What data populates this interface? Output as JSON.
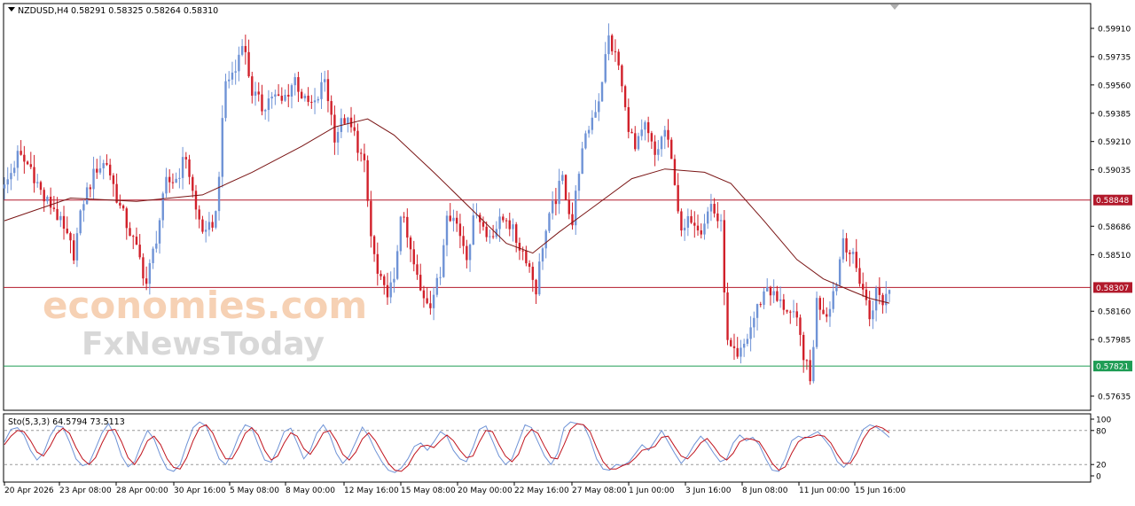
{
  "window": {
    "symbol_label": "NZDUSD,H4",
    "ohlc_label": "0.58291 0.58325 0.58264 0.58310",
    "stoch_label": "Sto(5,3,3) 64.5794 73.5113"
  },
  "watermark": {
    "line1": "economies.com",
    "line2": "FxNewsToday"
  },
  "colors": {
    "bull": "#6f93d6",
    "bear": "#d1202a",
    "ma": "#7a1515",
    "resistance": "#b2192b",
    "support": "#1f9d55",
    "stoch_main": "#6f93d6",
    "stoch_signal": "#c0141e"
  },
  "chart_data": [
    {
      "type": "candlestick",
      "title": "NZDUSD,H4",
      "ylim": [
        0.57635,
        0.5999
      ],
      "y_ticks": [
        "0.59910",
        "0.59735",
        "0.59560",
        "0.59385",
        "0.59210",
        "0.59035",
        "0.58686",
        "0.58510",
        "0.58160",
        "0.57985",
        "0.57635"
      ],
      "x_ticks": [
        "20 Apr 2026",
        "23 Apr 08:00",
        "28 Apr 00:00",
        "30 Apr 16:00",
        "5 May 08:00",
        "8 May 00:00",
        "12 May 16:00",
        "15 May 08:00",
        "20 May 00:00",
        "22 May 16:00",
        "27 May 08:00",
        "1 Jun 00:00",
        "3 Jun 16:00",
        "8 Jun 08:00",
        "11 Jun 00:00",
        "15 Jun 16:00"
      ],
      "levels": [
        {
          "value": "0.58848",
          "kind": "resistance"
        },
        {
          "value": "0.58307",
          "kind": "current"
        },
        {
          "value": "0.57821",
          "kind": "support"
        }
      ],
      "anchors": [
        [
          0,
          0.5892
        ],
        [
          4,
          0.5912
        ],
        [
          8,
          0.5905
        ],
        [
          12,
          0.5885
        ],
        [
          15,
          0.588
        ],
        [
          18,
          0.5865
        ],
        [
          21,
          0.5852
        ],
        [
          24,
          0.5885
        ],
        [
          28,
          0.5905
        ],
        [
          31,
          0.5908
        ],
        [
          35,
          0.588
        ],
        [
          38,
          0.5865
        ],
        [
          41,
          0.5848
        ],
        [
          43,
          0.5833
        ],
        [
          46,
          0.5862
        ],
        [
          49,
          0.5895
        ],
        [
          52,
          0.5898
        ],
        [
          55,
          0.5912
        ],
        [
          58,
          0.5878
        ],
        [
          61,
          0.5862
        ],
        [
          64,
          0.5876
        ],
        [
          67,
          0.5958
        ],
        [
          70,
          0.5965
        ],
        [
          72,
          0.5985
        ],
        [
          75,
          0.5952
        ],
        [
          78,
          0.5942
        ],
        [
          81,
          0.595
        ],
        [
          84,
          0.5945
        ],
        [
          88,
          0.596
        ],
        [
          91,
          0.5945
        ],
        [
          94,
          0.5943
        ],
        [
          97,
          0.596
        ],
        [
          100,
          0.5925
        ],
        [
          103,
          0.5935
        ],
        [
          106,
          0.5925
        ],
        [
          109,
          0.5905
        ],
        [
          111,
          0.5862
        ],
        [
          113,
          0.5838
        ],
        [
          115,
          0.5828
        ],
        [
          118,
          0.5832
        ],
        [
          120,
          0.5878
        ],
        [
          123,
          0.5852
        ],
        [
          126,
          0.5828
        ],
        [
          129,
          0.5822
        ],
        [
          132,
          0.5838
        ],
        [
          134,
          0.588
        ],
        [
          137,
          0.587
        ],
        [
          140,
          0.5852
        ],
        [
          143,
          0.588
        ],
        [
          146,
          0.5862
        ],
        [
          149,
          0.5868
        ],
        [
          152,
          0.5875
        ],
        [
          155,
          0.586
        ],
        [
          158,
          0.585
        ],
        [
          161,
          0.583
        ],
        [
          163,
          0.5858
        ],
        [
          166,
          0.588
        ],
        [
          169,
          0.5898
        ],
        [
          172,
          0.587
        ],
        [
          174,
          0.5905
        ],
        [
          177,
          0.593
        ],
        [
          180,
          0.5948
        ],
        [
          183,
          0.5985
        ],
        [
          186,
          0.5968
        ],
        [
          188,
          0.594
        ],
        [
          191,
          0.5915
        ],
        [
          194,
          0.593
        ],
        [
          197,
          0.5912
        ],
        [
          200,
          0.5928
        ],
        [
          203,
          0.5898
        ],
        [
          205,
          0.5862
        ],
        [
          208,
          0.5875
        ],
        [
          211,
          0.5868
        ],
        [
          214,
          0.5882
        ],
        [
          217,
          0.5868
        ],
        [
          219,
          0.5795
        ],
        [
          222,
          0.5785
        ],
        [
          225,
          0.58
        ],
        [
          228,
          0.5818
        ],
        [
          231,
          0.5832
        ],
        [
          234,
          0.5822
        ],
        [
          237,
          0.5818
        ],
        [
          240,
          0.5808
        ],
        [
          242,
          0.579
        ],
        [
          244,
          0.5772
        ],
        [
          246,
          0.5822
        ],
        [
          249,
          0.5815
        ],
        [
          252,
          0.5835
        ],
        [
          254,
          0.5862
        ],
        [
          257,
          0.5848
        ],
        [
          260,
          0.583
        ],
        [
          262,
          0.5812
        ],
        [
          264,
          0.5828
        ],
        [
          266,
          0.5822
        ],
        [
          268,
          0.5831
        ]
      ],
      "moving_average": [
        [
          0,
          0.5872
        ],
        [
          20,
          0.5886
        ],
        [
          40,
          0.5884
        ],
        [
          60,
          0.5888
        ],
        [
          75,
          0.5902
        ],
        [
          90,
          0.5918
        ],
        [
          100,
          0.593
        ],
        [
          110,
          0.5935
        ],
        [
          118,
          0.5925
        ],
        [
          130,
          0.5902
        ],
        [
          142,
          0.5878
        ],
        [
          152,
          0.5858
        ],
        [
          160,
          0.5852
        ],
        [
          168,
          0.5865
        ],
        [
          178,
          0.588
        ],
        [
          190,
          0.5898
        ],
        [
          200,
          0.5904
        ],
        [
          212,
          0.5902
        ],
        [
          220,
          0.5895
        ],
        [
          230,
          0.5872
        ],
        [
          240,
          0.5848
        ],
        [
          248,
          0.5836
        ],
        [
          256,
          0.5829
        ],
        [
          262,
          0.5824
        ],
        [
          268,
          0.5821
        ]
      ]
    },
    {
      "type": "line",
      "title": "Sto(5,3,3) 64.5794 73.5113",
      "ylim": [
        0,
        100
      ],
      "y_ticks": [
        "100",
        "80",
        "20",
        "0"
      ],
      "levels": [
        80,
        20
      ],
      "series": [
        {
          "name": "main",
          "values": [
            60,
            82,
            85,
            72,
            45,
            28,
            40,
            70,
            88,
            86,
            60,
            30,
            18,
            22,
            48,
            76,
            92,
            70,
            35,
            16,
            25,
            55,
            80,
            65,
            35,
            12,
            8,
            20,
            55,
            85,
            95,
            88,
            60,
            30,
            20,
            40,
            70,
            90,
            85,
            55,
            28,
            24,
            48,
            78,
            84,
            58,
            30,
            45,
            75,
            90,
            72,
            40,
            22,
            35,
            60,
            86,
            70,
            45,
            25,
            10,
            6,
            14,
            30,
            52,
            58,
            45,
            60,
            78,
            70,
            45,
            30,
            25,
            50,
            82,
            88,
            62,
            35,
            20,
            30,
            60,
            90,
            85,
            60,
            35,
            20,
            40,
            85,
            95,
            92,
            90,
            65,
            30,
            12,
            10,
            20,
            18,
            25,
            40,
            55,
            45,
            62,
            80,
            60,
            40,
            22,
            35,
            55,
            70,
            58,
            40,
            25,
            30,
            58,
            72,
            62,
            68,
            55,
            30,
            10,
            8,
            30,
            62,
            70,
            66,
            72,
            78,
            65,
            50,
            25,
            15,
            28,
            58,
            82,
            90,
            86,
            78,
            68
          ]
        },
        {
          "name": "signal",
          "values": [
            55,
            70,
            80,
            78,
            62,
            42,
            35,
            52,
            74,
            84,
            75,
            50,
            30,
            20,
            32,
            58,
            80,
            82,
            60,
            32,
            20,
            38,
            62,
            70,
            55,
            30,
            15,
            12,
            32,
            62,
            85,
            90,
            76,
            50,
            30,
            30,
            50,
            75,
            85,
            72,
            45,
            28,
            35,
            58,
            76,
            70,
            48,
            38,
            55,
            76,
            80,
            62,
            38,
            28,
            42,
            65,
            76,
            62,
            42,
            22,
            10,
            8,
            18,
            38,
            52,
            54,
            50,
            62,
            72,
            62,
            45,
            32,
            35,
            60,
            80,
            78,
            55,
            35,
            25,
            38,
            68,
            82,
            75,
            52,
            32,
            30,
            55,
            82,
            92,
            90,
            78,
            50,
            25,
            12,
            12,
            18,
            22,
            32,
            45,
            48,
            52,
            68,
            70,
            52,
            35,
            30,
            42,
            58,
            66,
            52,
            36,
            28,
            40,
            60,
            66,
            64,
            60,
            42,
            22,
            10,
            16,
            40,
            60,
            68,
            68,
            72,
            70,
            58,
            38,
            22,
            22,
            40,
            65,
            82,
            88,
            84,
            76
          ]
        }
      ]
    }
  ]
}
